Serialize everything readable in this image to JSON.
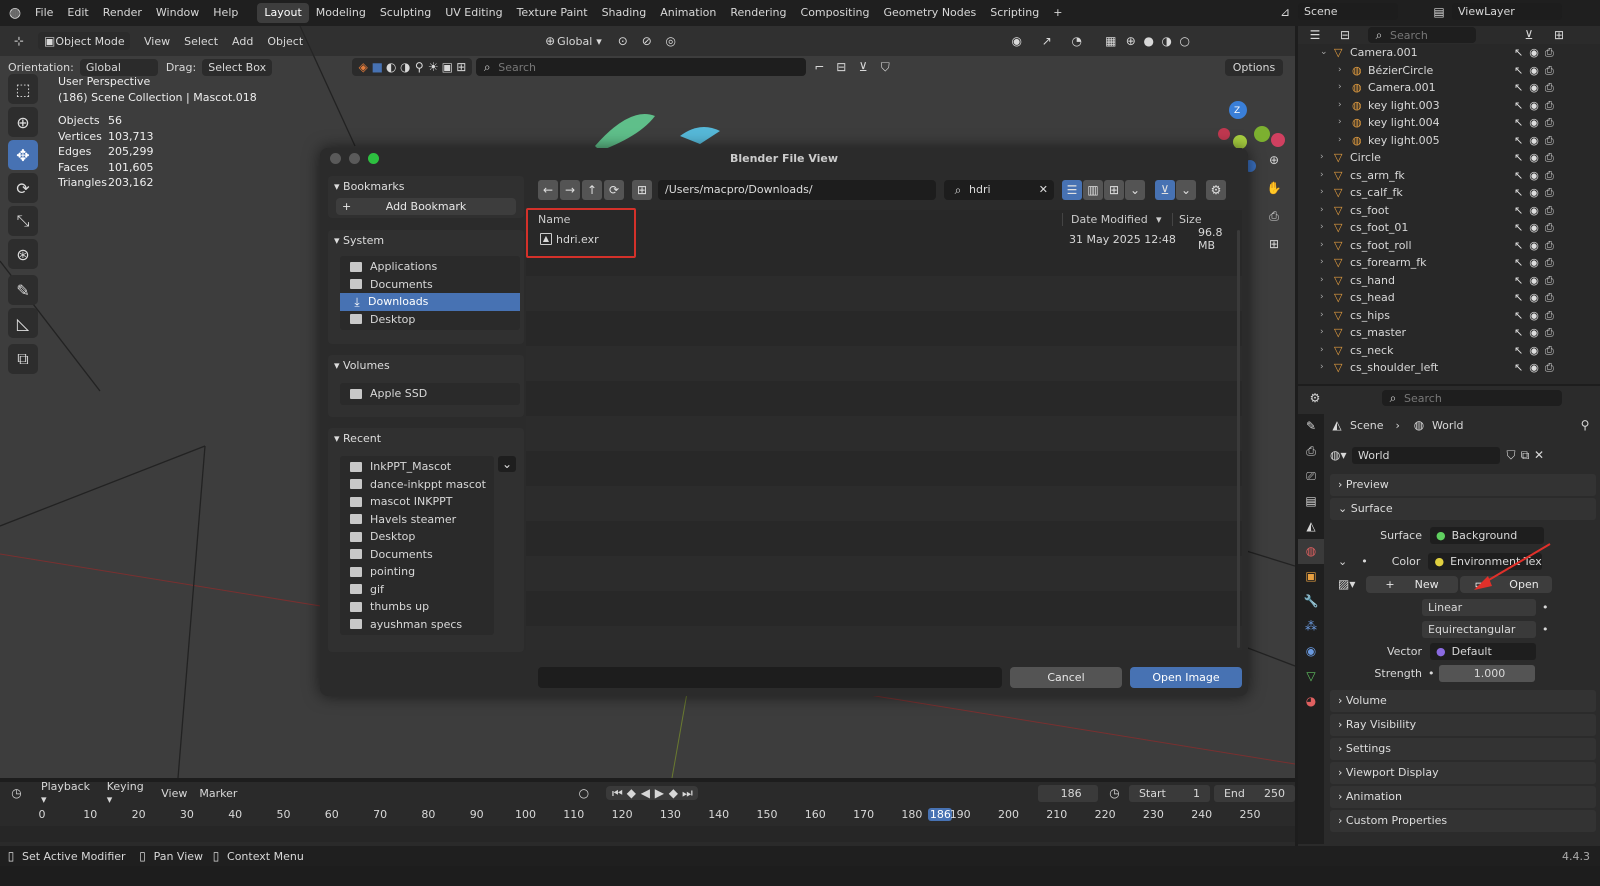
{
  "topbar": {
    "menu": [
      "File",
      "Edit",
      "Render",
      "Window",
      "Help"
    ],
    "workspaces": [
      "Layout",
      "Modeling",
      "Sculpting",
      "UV Editing",
      "Texture Paint",
      "Shading",
      "Animation",
      "Rendering",
      "Compositing",
      "Geometry Nodes",
      "Scripting"
    ],
    "scene": "Scene",
    "viewlayer": "ViewLayer"
  },
  "vheader": {
    "mode": "Object Mode",
    "menus": [
      "View",
      "Select",
      "Add",
      "Object"
    ],
    "transform": "Global",
    "orientation_label": "Orientation:",
    "orientation": "Global",
    "drag_label": "Drag:",
    "drag": "Select Box",
    "search_placeholder": "Search",
    "options": "Options"
  },
  "overlay": {
    "line1": "User Perspective",
    "line2": "(186) Scene Collection | Mascot.018",
    "stats": [
      {
        "k": "Objects",
        "v": "56"
      },
      {
        "k": "Vertices",
        "v": "103,713"
      },
      {
        "k": "Edges",
        "v": "205,299"
      },
      {
        "k": "Faces",
        "v": "101,605"
      },
      {
        "k": "Triangles",
        "v": "203,162"
      }
    ]
  },
  "dialog": {
    "title": "Blender File View",
    "bookmarks_title": "Bookmarks",
    "add_bookmark": "Add Bookmark",
    "system_title": "System",
    "system": [
      "Applications",
      "Documents",
      "Downloads",
      "Desktop"
    ],
    "volumes_title": "Volumes",
    "volumes": [
      "Apple SSD"
    ],
    "recent_title": "Recent",
    "recent": [
      "InkPPT_Mascot",
      "dance-inkppt mascot",
      "mascot INKPPT",
      "Havels steamer",
      "Desktop",
      "Documents",
      "pointing",
      "gif",
      "thumbs up",
      "ayushman specs"
    ],
    "path": "/Users/macpro/Downloads/",
    "filter": "hdri",
    "col_name": "Name",
    "col_date": "Date Modified",
    "col_size": "Size",
    "files": [
      {
        "name": "hdri.exr",
        "date": "31 May 2025 12:48",
        "size": "96.8 MB"
      }
    ],
    "cancel": "Cancel",
    "open": "Open Image"
  },
  "outliner": {
    "search_placeholder": "Search",
    "rows": [
      {
        "n": "Camera.001",
        "d": 1
      },
      {
        "n": "BézierCircle",
        "d": 2
      },
      {
        "n": "Camera.001",
        "d": 2
      },
      {
        "n": "key light.003",
        "d": 2
      },
      {
        "n": "key light.004",
        "d": 2
      },
      {
        "n": "key light.005",
        "d": 2
      },
      {
        "n": "Circle",
        "d": 1
      },
      {
        "n": "cs_arm_fk",
        "d": 1
      },
      {
        "n": "cs_calf_fk",
        "d": 1
      },
      {
        "n": "cs_foot",
        "d": 1
      },
      {
        "n": "cs_foot_01",
        "d": 1
      },
      {
        "n": "cs_foot_roll",
        "d": 1
      },
      {
        "n": "cs_forearm_fk",
        "d": 1
      },
      {
        "n": "cs_hand",
        "d": 1
      },
      {
        "n": "cs_head",
        "d": 1
      },
      {
        "n": "cs_hips",
        "d": 1
      },
      {
        "n": "cs_master",
        "d": 1
      },
      {
        "n": "cs_neck",
        "d": 1
      },
      {
        "n": "cs_shoulder_left",
        "d": 1
      }
    ]
  },
  "props": {
    "search_placeholder": "Search",
    "breadcrumb_scene": "Scene",
    "breadcrumb_world": "World",
    "world_name": "World",
    "preview": "Preview",
    "surface": "Surface",
    "surface_label": "Surface",
    "surface_value": "Background",
    "color_label": "Color",
    "color_value": "Environment Texture",
    "new": "New",
    "open": "Open",
    "interp": "Linear",
    "proj": "Equirectangular",
    "vector_label": "Vector",
    "vector_value": "Default",
    "strength_label": "Strength",
    "strength_value": "1.000",
    "sections": [
      "Volume",
      "Ray Visibility",
      "Settings",
      "Viewport Display",
      "Animation",
      "Custom Properties"
    ]
  },
  "timeline": {
    "menus": [
      "Playback",
      "Keying",
      "View",
      "Marker"
    ],
    "current": "186",
    "start_label": "Start",
    "start": "1",
    "end_label": "End",
    "end": "250",
    "ticks": [
      "0",
      "10",
      "20",
      "30",
      "40",
      "50",
      "60",
      "70",
      "80",
      "90",
      "100",
      "110",
      "120",
      "130",
      "140",
      "150",
      "160",
      "170",
      "180",
      "186",
      "190",
      "200",
      "210",
      "220",
      "230",
      "240",
      "250"
    ]
  },
  "status": {
    "left": "Set Active Modifier",
    "mid": "Pan View",
    "right": "Context Menu",
    "version": "4.4.3"
  },
  "colors": {
    "accent": "#4772b3",
    "highlight_box": "#d4312a",
    "arrow": "#e0302a"
  }
}
